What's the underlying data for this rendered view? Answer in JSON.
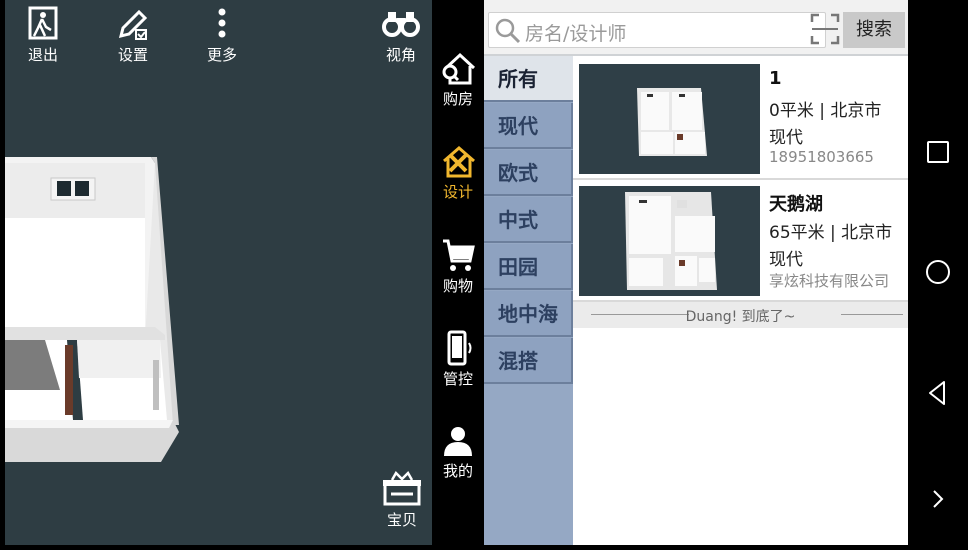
{
  "toolbar": {
    "exit_label": "退出",
    "settings_label": "设置",
    "more_label": "更多",
    "view_label": "视角",
    "gift_label": "宝贝"
  },
  "nav": {
    "buy_house": "购房",
    "design": "设计",
    "shopping": "购物",
    "control": "管控",
    "mine": "我的"
  },
  "search": {
    "placeholder": "房名/设计师",
    "button_label": "搜索"
  },
  "categories": [
    "所有",
    "现代",
    "欧式",
    "中式",
    "田园",
    "地中海",
    "混搭"
  ],
  "listings": [
    {
      "title": "1",
      "area_city": "0平米 | 北京市",
      "style": "现代",
      "contact": "18951803665"
    },
    {
      "title": "天鹅湖",
      "area_city": "65平米 | 北京市",
      "style": "现代",
      "contact": "享炫科技有限公司"
    }
  ],
  "list_end_text": "Duang! 到底了~",
  "colors": {
    "viewport_bg": "#2e3d43",
    "active_nav": "#f1b72e",
    "category_bg": "#8ea2c0",
    "category_active_bg": "#dfe4ea"
  }
}
